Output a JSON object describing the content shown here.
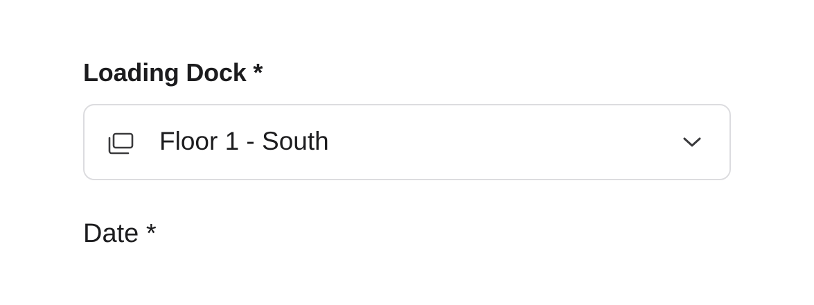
{
  "form": {
    "loading_dock": {
      "label": "Loading Dock *",
      "selected_value": "Floor 1 - South",
      "leading_icon": "stacked-windows-icon",
      "trailing_icon": "chevron-down-icon"
    },
    "date": {
      "label": "Date *"
    }
  },
  "colors": {
    "text": "#1c1c1e",
    "border": "#dcdcdf",
    "icon": "#3a3a3c"
  }
}
